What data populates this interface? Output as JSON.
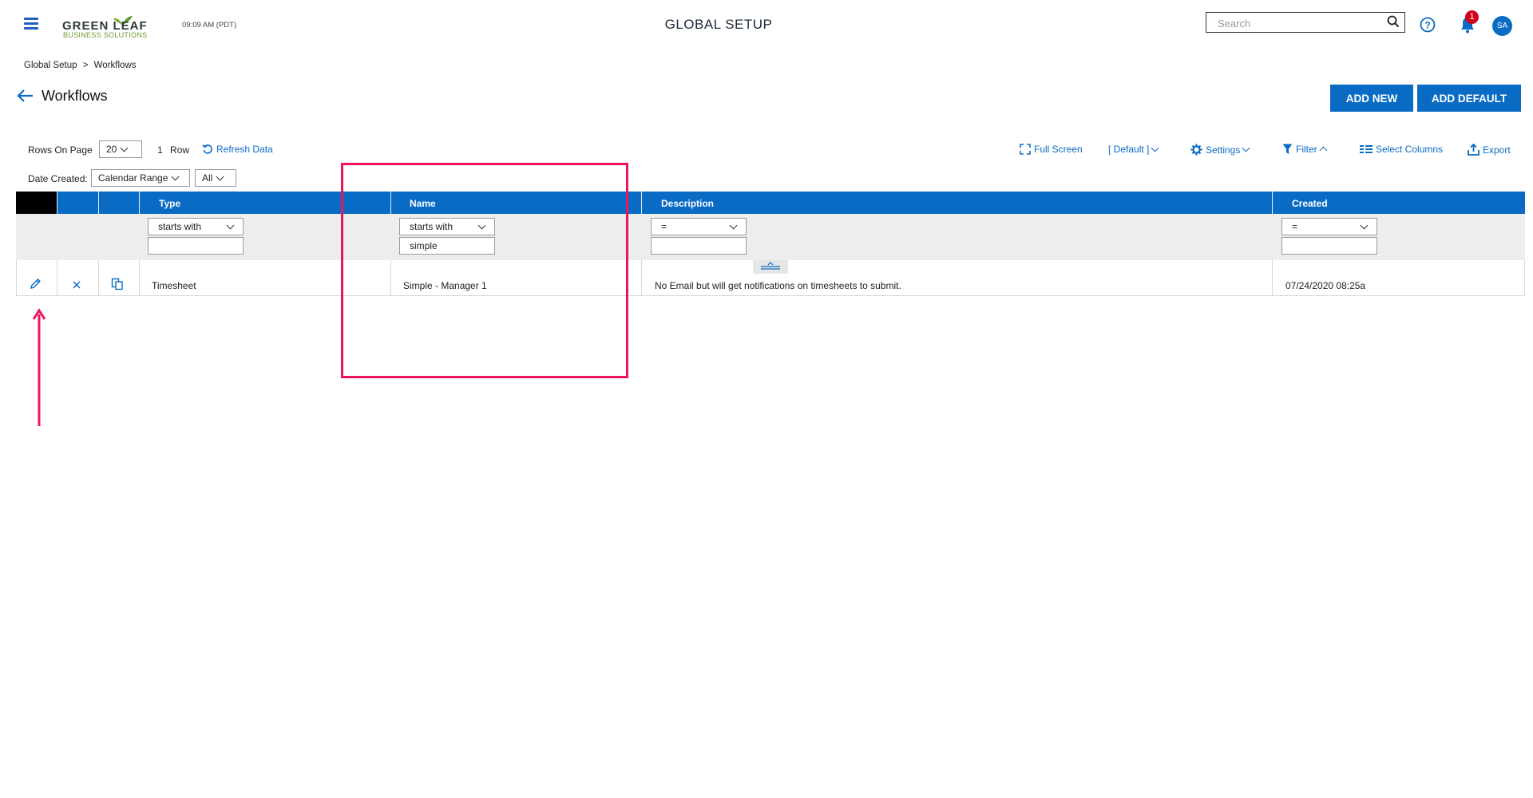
{
  "header": {
    "logo_line1": "GREEN LEAF",
    "logo_line2": "BUSINESS SOLUTIONS",
    "clock": "09:09 AM (PDT)",
    "app_title": "GLOBAL SETUP",
    "search_placeholder": "Search",
    "notification_count": "1",
    "avatar_initials": "SA",
    "icons": [
      "menu-icon",
      "search-icon",
      "help-icon",
      "bell-icon"
    ]
  },
  "breadcrumb": {
    "root": "Global Setup",
    "separator": ">",
    "current": "Workflows"
  },
  "page": {
    "title": "Workflows",
    "add_new_label": "ADD NEW",
    "add_default_label": "ADD DEFAULT"
  },
  "toolbar": {
    "rows_on_page_label": "Rows On Page",
    "rows_on_page_value": "20",
    "row_count": "1",
    "row_count_label": "Row",
    "refresh_label": "Refresh Data",
    "full_screen_label": "Full Screen",
    "view_label": "[ Default ]",
    "settings_label": "Settings",
    "filter_label": "Filter",
    "select_columns_label": "Select Columns",
    "export_label": "Export",
    "date_created_label": "Date Created:",
    "date_range_value": "Calendar Range",
    "date_all_value": "All"
  },
  "grid": {
    "columns": [
      "Type",
      "Name",
      "Description",
      "Created"
    ],
    "filters": {
      "type": {
        "operator": "starts with",
        "value": ""
      },
      "name": {
        "operator": "starts with",
        "value": "simple"
      },
      "description": {
        "operator": "=",
        "value": ""
      },
      "created": {
        "operator": "=",
        "value": ""
      }
    },
    "rows": [
      {
        "type": "Timesheet",
        "name": "Simple - Manager 1",
        "description": "No Email but will get notifications on timesheets to submit.",
        "created": "07/24/2020 08:25a"
      }
    ],
    "row_action_icons": [
      "edit-icon",
      "delete-icon",
      "copy-icon"
    ]
  },
  "colors": {
    "brand_blue": "#0a6bc4",
    "annotation_pink": "#f0145a",
    "badge_red": "#d0021b",
    "logo_green": "#6c9a2f"
  }
}
